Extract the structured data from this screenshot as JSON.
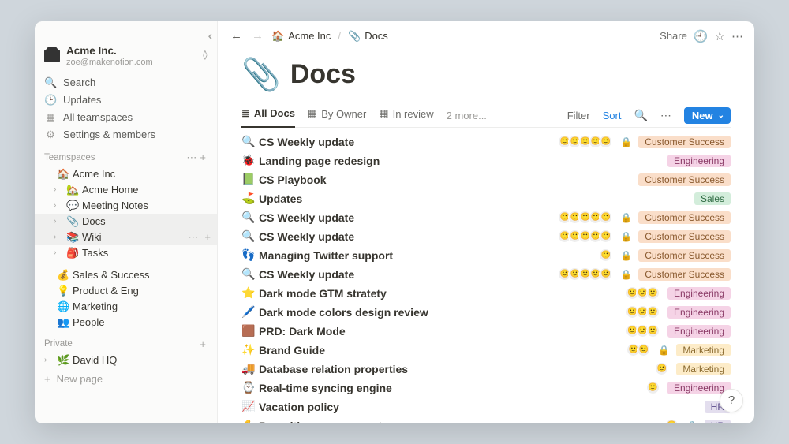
{
  "workspace": {
    "name": "Acme Inc.",
    "email": "zoe@makenotion.com"
  },
  "sidebar_top": [
    {
      "icon": "🔍",
      "label": "Search"
    },
    {
      "icon": "🕒",
      "label": "Updates"
    },
    {
      "icon": "▦",
      "label": "All teamspaces"
    },
    {
      "icon": "⚙",
      "label": "Settings & members"
    }
  ],
  "teamspaces_label": "Teamspaces",
  "teamspaces": [
    {
      "emoji": "🏠",
      "label": "Acme Inc",
      "caret": "",
      "top": true
    },
    {
      "emoji": "🏡",
      "label": "Acme Home",
      "caret": "›",
      "indent": true
    },
    {
      "emoji": "💬",
      "label": "Meeting Notes",
      "caret": "›",
      "indent": true
    },
    {
      "emoji": "📎",
      "label": "Docs",
      "caret": "›",
      "indent": true,
      "active": true
    },
    {
      "emoji": "📚",
      "label": "Wiki",
      "caret": "›",
      "indent": true,
      "hovered": true
    },
    {
      "emoji": "🎒",
      "label": "Tasks",
      "caret": "›",
      "indent": true
    }
  ],
  "team_groups": [
    {
      "emoji": "💰",
      "label": "Sales & Success"
    },
    {
      "emoji": "💡",
      "label": "Product & Eng"
    },
    {
      "emoji": "🌐",
      "label": "Marketing"
    },
    {
      "emoji": "👥",
      "label": "People"
    }
  ],
  "private_label": "Private",
  "private_items": [
    {
      "emoji": "🌿",
      "label": "David HQ",
      "caret": "›"
    }
  ],
  "new_page_label": "New page",
  "breadcrumb": {
    "root_emoji": "🏠",
    "root": "Acme Inc",
    "page_emoji": "📎",
    "page": "Docs"
  },
  "topbar": {
    "share": "Share"
  },
  "page": {
    "emoji": "📎",
    "title": "Docs"
  },
  "views": {
    "items": [
      {
        "icon": "≣",
        "label": "All Docs",
        "active": true
      },
      {
        "icon": "▦",
        "label": "By Owner"
      },
      {
        "icon": "▦",
        "label": "In review"
      }
    ],
    "more": "2 more...",
    "filter": "Filter",
    "sort": "Sort",
    "new": "New"
  },
  "tags": {
    "cs": "Customer Success",
    "eng": "Engineering",
    "sales": "Sales",
    "mkt": "Marketing",
    "hr": "HR"
  },
  "rows": [
    {
      "emoji": "🔍",
      "title": "CS Weekly update",
      "avatars": 5,
      "lock": true,
      "tag": "cs"
    },
    {
      "emoji": "🐞",
      "title": "Landing page redesign",
      "avatars": 0,
      "tag": "eng"
    },
    {
      "emoji": "📗",
      "title": "CS Playbook",
      "avatars": 0,
      "tag": "cs"
    },
    {
      "emoji": "⛳",
      "title": "Updates",
      "avatars": 0,
      "tag": "sales"
    },
    {
      "emoji": "🔍",
      "title": "CS Weekly update",
      "avatars": 5,
      "lock": true,
      "tag": "cs"
    },
    {
      "emoji": "🔍",
      "title": "CS Weekly update",
      "avatars": 5,
      "lock": true,
      "tag": "cs"
    },
    {
      "emoji": "👣",
      "title": "Managing Twitter support",
      "avatars": 1,
      "lock": true,
      "tag": "cs"
    },
    {
      "emoji": "🔍",
      "title": "CS Weekly update",
      "avatars": 5,
      "lock": true,
      "tag": "cs"
    },
    {
      "emoji": "⭐",
      "title": "Dark mode GTM stratety",
      "avatars": 3,
      "tag": "eng"
    },
    {
      "emoji": "🖊️",
      "title": "Dark mode colors design review",
      "avatars": 3,
      "tag": "eng"
    },
    {
      "emoji": "🟫",
      "title": "PRD: Dark Mode",
      "avatars": 3,
      "tag": "eng"
    },
    {
      "emoji": "✨",
      "title": "Brand Guide",
      "avatars": 2,
      "lock": true,
      "tag": "mkt"
    },
    {
      "emoji": "🚚",
      "title": "Database relation properties",
      "avatars": 1,
      "tag": "mkt"
    },
    {
      "emoji": "⌚",
      "title": "Real-time syncing engine",
      "avatars": 1,
      "tag": "eng"
    },
    {
      "emoji": "📈",
      "title": "Vacation policy",
      "avatars": 0,
      "tag": "hr"
    },
    {
      "emoji": "💪",
      "title": "Recruiting new support reps",
      "avatars": 1,
      "lock": true,
      "tag": "hr"
    }
  ]
}
